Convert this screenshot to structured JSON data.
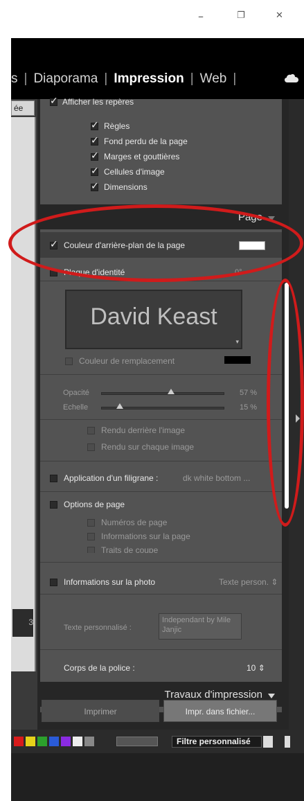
{
  "window": {
    "minimize": "–",
    "restore": "❐",
    "close": "✕"
  },
  "modules": {
    "partial": "s",
    "slideshow": "Diaporama",
    "print": "Impression",
    "web": "Web"
  },
  "left_panel": {
    "tab_label": "ée",
    "counter": "3"
  },
  "guides": {
    "show_guides": "Afficher les repères",
    "rulers": "Règles",
    "bleed": "Fond perdu de la page",
    "margins": "Marges et gouttières",
    "cells": "Cellules d'image",
    "dimensions": "Dimensions"
  },
  "page_section": {
    "title": "Page",
    "bg_color_label": "Couleur d'arrière-plan de la page",
    "bg_color": "#ffffff",
    "identity_plate_label": "Plaque d'identité",
    "identity_angle": "0°",
    "identity_text": "David Keast",
    "override_color_label": "Couleur de remplacement",
    "opacity_label": "Opacité",
    "opacity_value": "57 %",
    "opacity_fraction": 0.57,
    "scale_label": "Echelle",
    "scale_value": "15 %",
    "scale_fraction": 0.15,
    "render_behind": "Rendu derrière l'image",
    "render_every": "Rendu sur chaque image",
    "watermark_label": "Application d'un filigrane :",
    "watermark_value": "dk white bottom ...",
    "page_options_label": "Options de page",
    "page_numbers": "Numéros de page",
    "page_info": "Informations sur la page",
    "crop_marks": "Traits de coupe",
    "photo_info_label": "Informations sur la photo",
    "photo_info_value": "Texte person.",
    "custom_text_label": "Texte personnalisé :",
    "custom_text_value": "Independant  by Mile Janjic",
    "font_size_label": "Corps de la police :",
    "font_size_value": "10"
  },
  "print_jobs": {
    "title": "Travaux d'impression"
  },
  "buttons": {
    "print": "Imprimer",
    "print_to_file": "Impr. dans fichier..."
  },
  "filmstrip": {
    "filter": "Filtre personnalisé",
    "colors": [
      "#d81b1b",
      "#e6d21a",
      "#2ca02c",
      "#2a5bd8",
      "#8a2be2",
      "#eeeeee",
      "#888888"
    ]
  },
  "annotation_color": "#d01b1b"
}
